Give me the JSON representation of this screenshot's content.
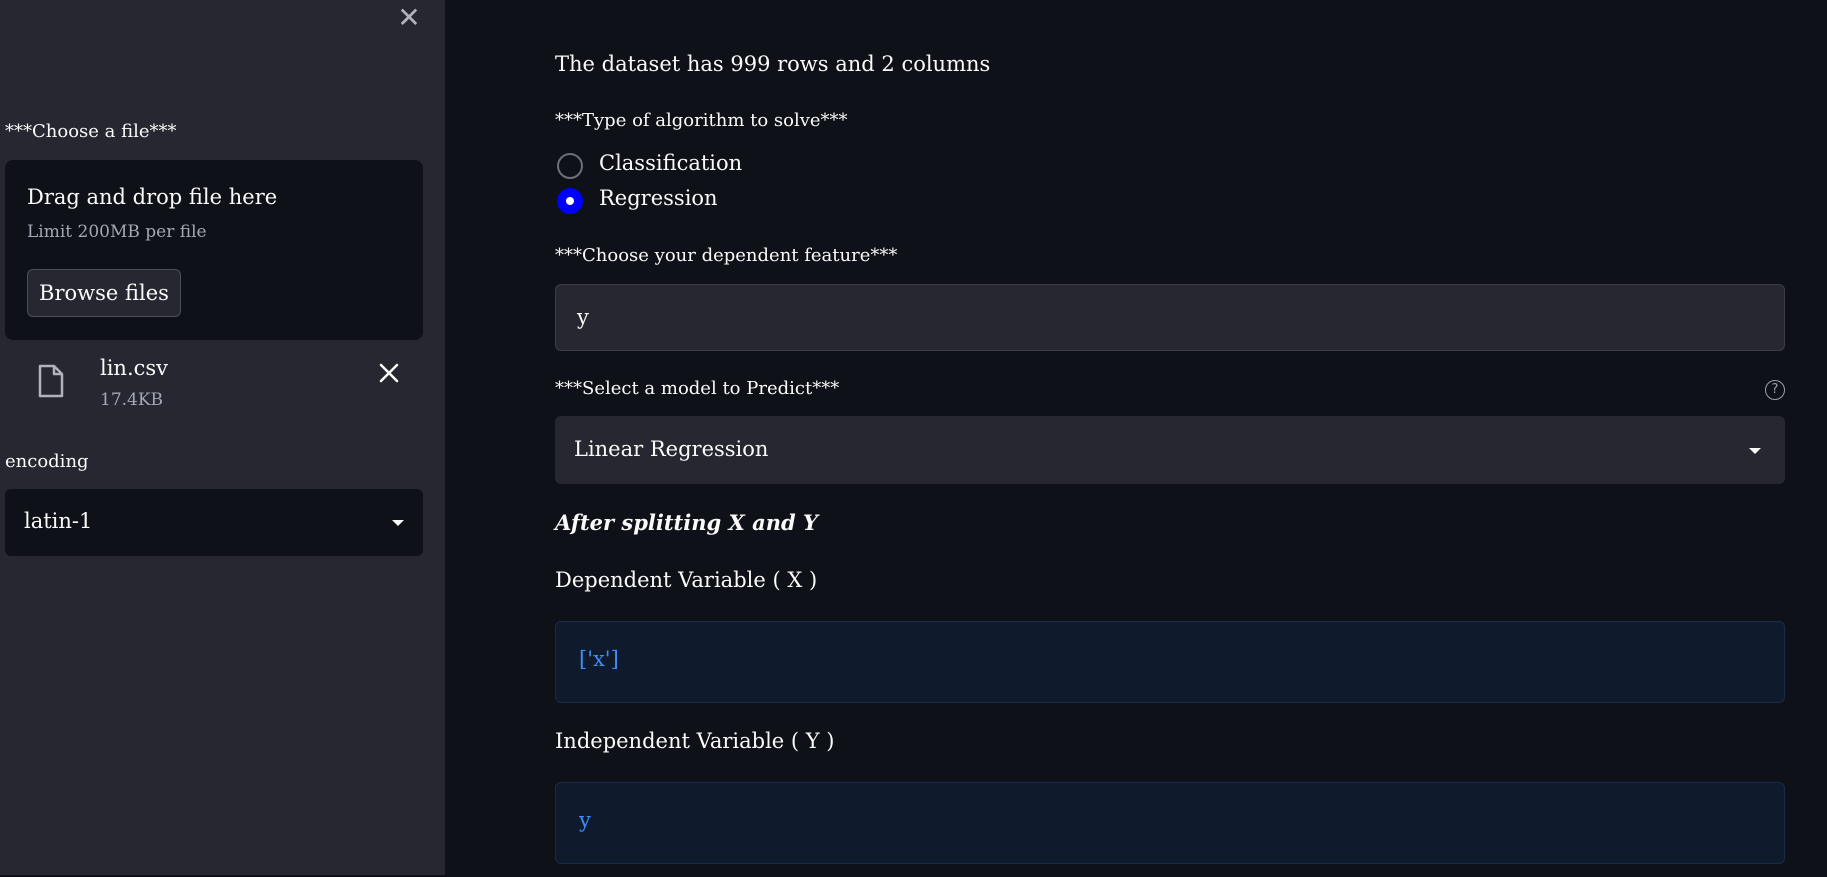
{
  "sidebar": {
    "close_icon": "close-icon",
    "file_label": "***Choose a file***",
    "dropzone": {
      "title": "Drag and drop file here",
      "limit": "Limit 200MB per file",
      "browse_label": "Browse files"
    },
    "uploaded_file": {
      "name": "lin.csv",
      "size": "17.4KB",
      "icon": "file-icon",
      "remove_icon": "close-icon"
    },
    "encoding": {
      "label": "encoding",
      "value": "latin-1"
    }
  },
  "main": {
    "dataset_info": "The dataset has 999 rows and 2 columns",
    "algorithm": {
      "label": "***Type of algorithm to solve***",
      "options": [
        "Classification",
        "Regression"
      ],
      "selected": "Regression"
    },
    "dependent_feature": {
      "label": "***Choose your dependent feature***",
      "value": "y"
    },
    "model": {
      "label": "***Select a model to Predict***",
      "help_icon": "?",
      "value": "Linear Regression"
    },
    "split_heading": "After splitting X and Y",
    "x_section": {
      "label": "Dependent Variable ( X )",
      "value": "['x']"
    },
    "y_section": {
      "label": "Independent Variable ( Y )",
      "value": "y"
    }
  },
  "colors": {
    "background": "#0e1117",
    "sidebar": "#262730",
    "accent_radio": "#0000ff",
    "info_text": "#3d8bfd"
  }
}
